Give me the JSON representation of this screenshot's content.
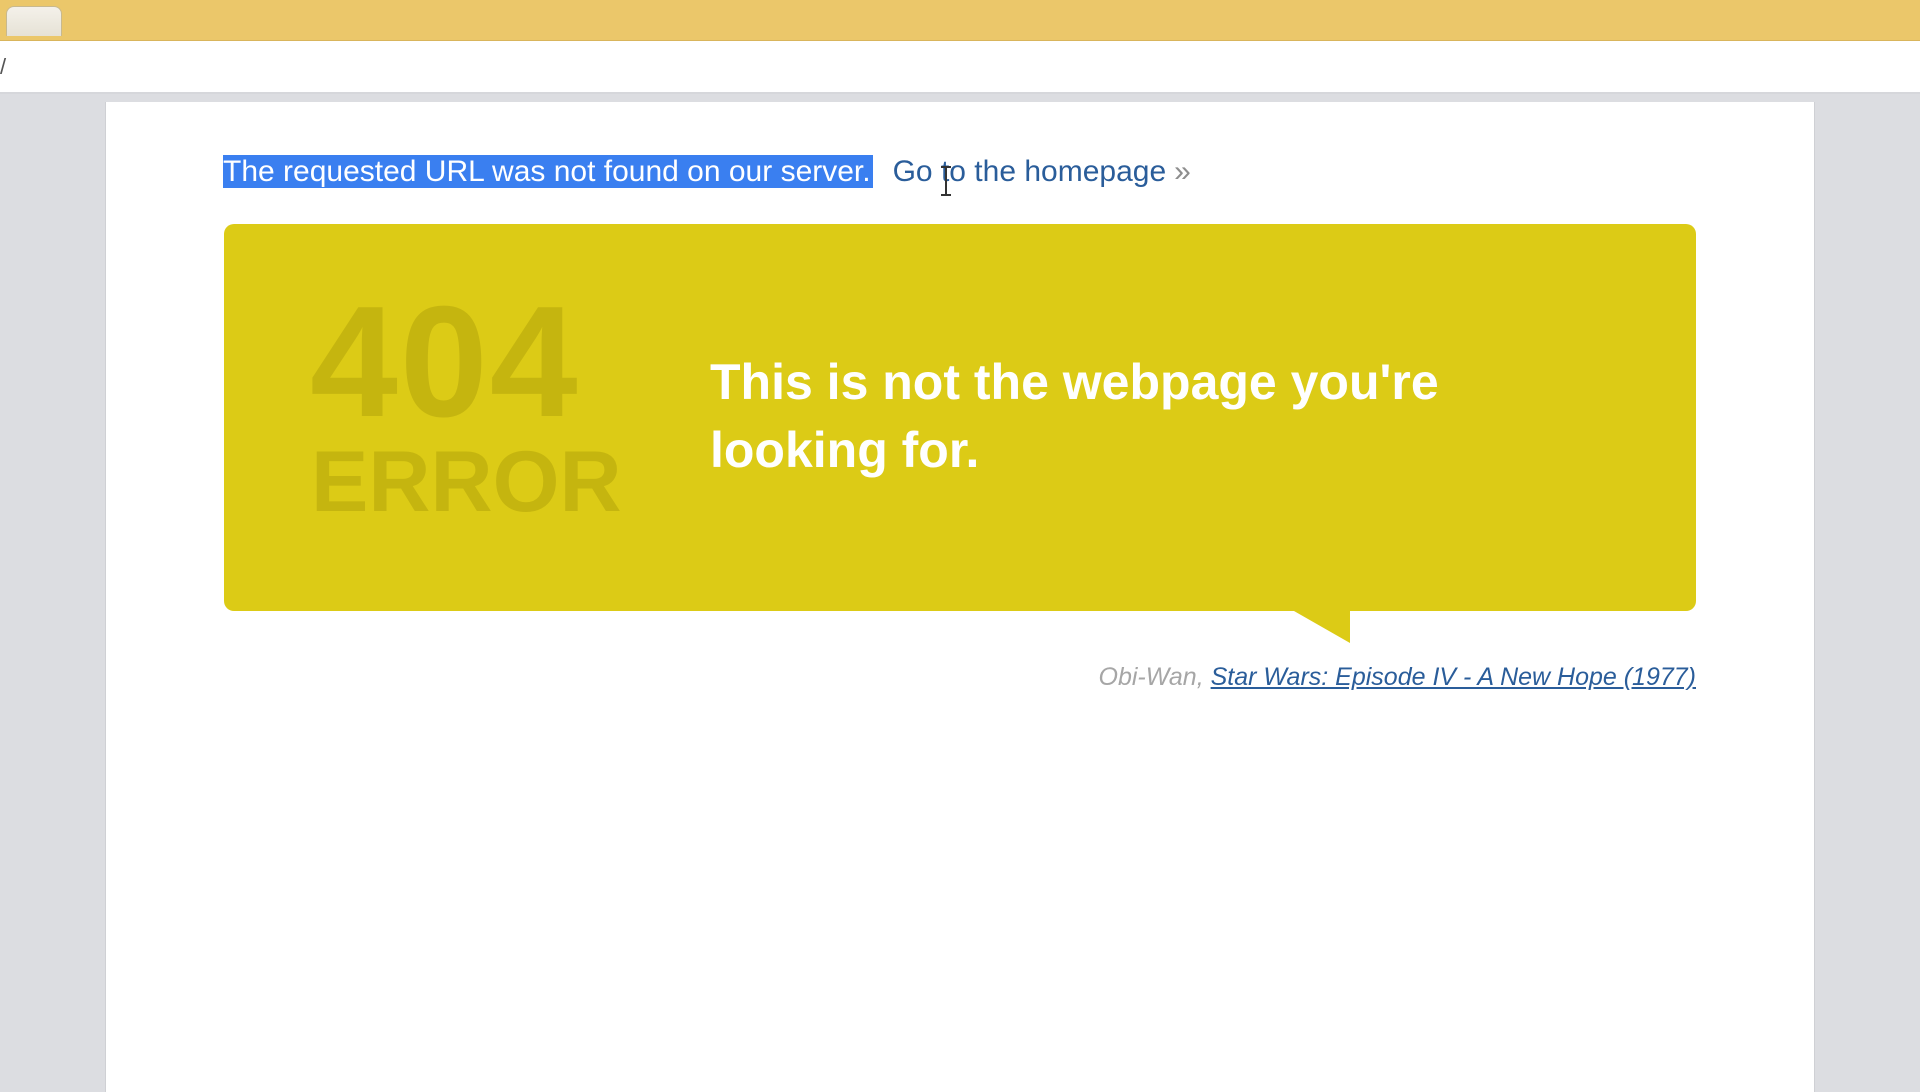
{
  "browser": {
    "address_text": "/"
  },
  "page": {
    "not_found_message": "The requested URL was not found on our server.",
    "homepage_link": "Go to the homepage",
    "homepage_arrow": "»",
    "error_code": "404",
    "error_word": "ERROR",
    "headline": "This is not the webpage you're looking for.",
    "quote_author": "Obi-Wan, ",
    "quote_source": "Star Wars: Episode IV - A New Hope (1977)"
  },
  "colors": {
    "titlebar": "#ebc76a",
    "banner": "#dccb16",
    "error_text": "#c5b50f",
    "selection": "#3a7ff0",
    "link": "#2a5d9a"
  },
  "icons": {
    "cursor": "text-cursor-icon"
  }
}
